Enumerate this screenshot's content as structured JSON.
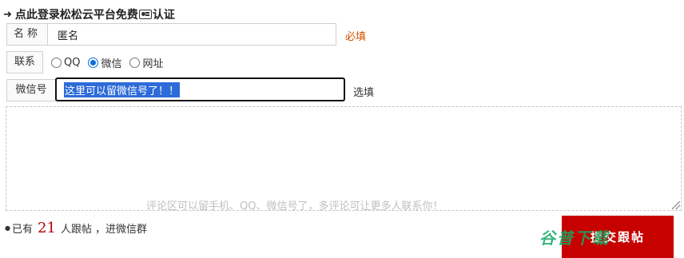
{
  "header": {
    "title_prefix": "点此登录松松云平台免费",
    "title_suffix": "认证",
    "login_icon": "login-arrow-icon",
    "card_icon": "id-card-icon"
  },
  "name_row": {
    "label": "名称",
    "value": "匿名",
    "required_text": "必填"
  },
  "contact_row": {
    "label": "联系",
    "options": [
      {
        "label": "QQ",
        "selected": false
      },
      {
        "label": "微信",
        "selected": true
      },
      {
        "label": "网址",
        "selected": false
      }
    ]
  },
  "wechat_row": {
    "label": "微信号",
    "value": "这里可以留微信号了！！",
    "optional_text": "选填"
  },
  "comment": {
    "placeholder": "评论区可以留手机、QQ、微信号了，多评论可让更多人联系你！"
  },
  "footer": {
    "prefix": "已有",
    "count": "21",
    "suffix": "人跟帖 ，进微信群"
  },
  "submit": {
    "label": "提交跟帖"
  },
  "watermark": {
    "text": "谷普下载"
  },
  "colors": {
    "accent": "#c70000",
    "required": "#d35400",
    "radio_checked": "#0a6fd8"
  }
}
